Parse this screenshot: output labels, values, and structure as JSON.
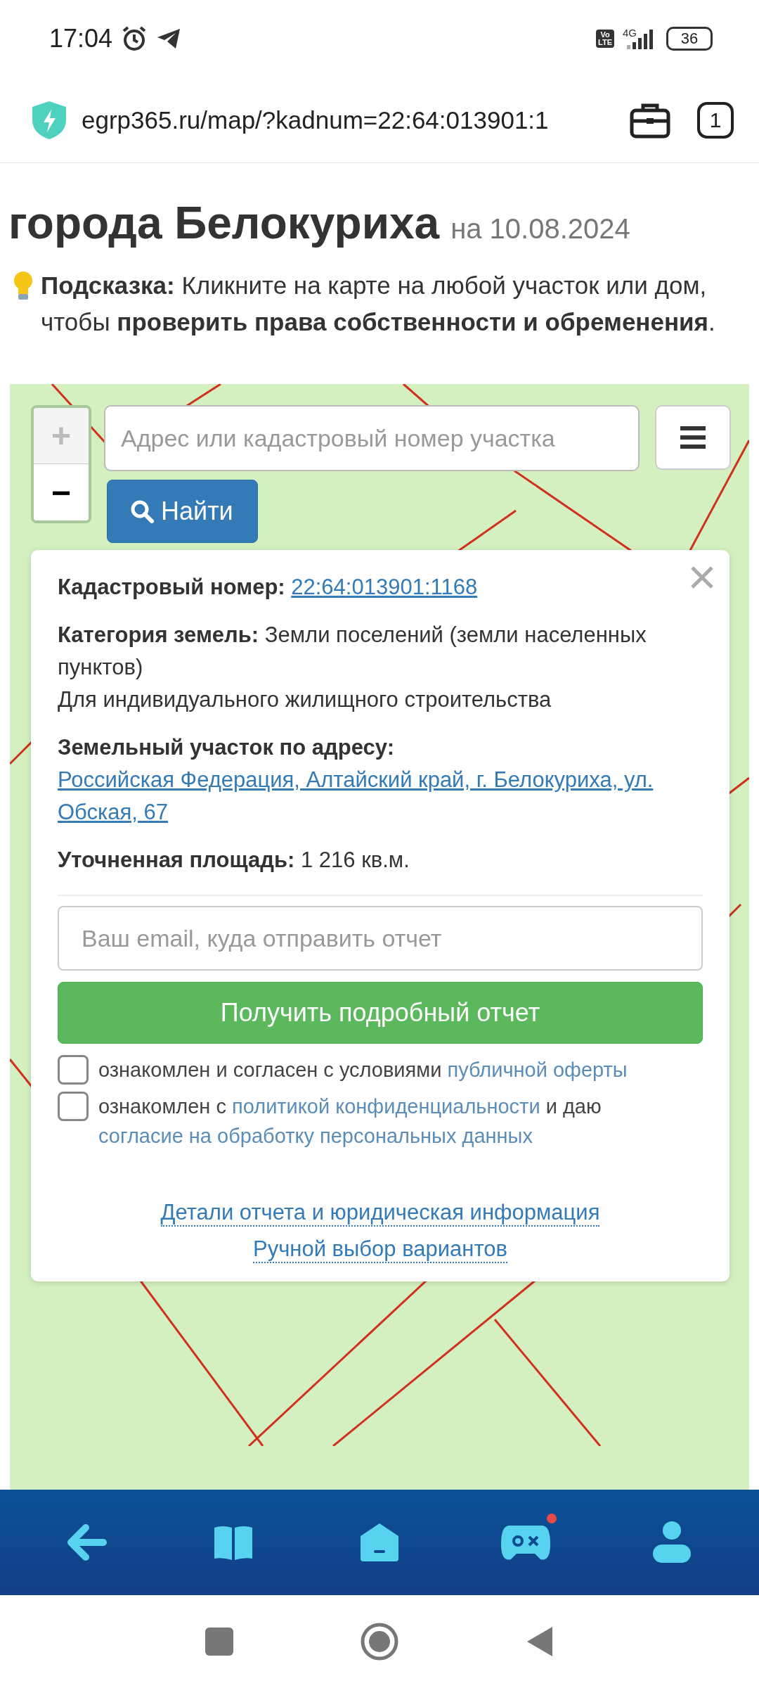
{
  "status_bar": {
    "time": "17:04",
    "volte": [
      "Vo",
      "LTE"
    ],
    "network": "4G",
    "battery": "36"
  },
  "browser": {
    "url": "egrp365.ru/map/?kadnum=22:64:013901:1",
    "tab_count": "1"
  },
  "heading": {
    "title": "города Белокуриха",
    "date": "на 10.08.2024"
  },
  "hint": "**Подсказка:** Кликните на карте на любой участок или дом, чтобы **проверить права собственности и обременения**.",
  "map": {
    "kind": "picture",
    "zoom_in": {
      "label": "+",
      "disabled": true
    },
    "zoom_out": {
      "label": "−",
      "disabled": false
    },
    "search": {
      "placeholder": "Адрес или кадастровый номер участка"
    },
    "find_button": "Найти"
  },
  "popup": {
    "fields": [
      {
        "label": "Кадастровый номер:",
        "value": "22:64:013901:1168",
        "kind": "link"
      },
      {
        "label": "Категория земель:",
        "value": "Земли поселений (земли населенных пунктов)",
        "note": "Для индивидуального жилищного строительства",
        "kind": "text"
      },
      {
        "label": "Земельный участок по адресу:",
        "value": "Российская Федерация, Алтайский край, г. Белокуриха, ул. Обская, 67",
        "kind": "link"
      },
      {
        "label": "Уточненная площадь:",
        "value": "1 216 кв.м.",
        "kind": "text"
      }
    ],
    "email": {
      "placeholder": "Ваш email, куда отправить отчет"
    },
    "submit": "Получить подробный отчет",
    "consents": [
      {
        "checked": false,
        "parts": [
          {
            "text": "ознакомлен и согласен с условиями ",
            "link": false
          },
          {
            "text": "публичной оферты",
            "link": true
          }
        ]
      },
      {
        "checked": false,
        "parts": [
          {
            "text": "ознакомлен с ",
            "link": false
          },
          {
            "text": "политикой конфиденциальности",
            "link": true
          },
          {
            "text": " и даю ",
            "link": false
          },
          {
            "text": "согласие на обработку персональных данных",
            "link": true
          }
        ]
      }
    ],
    "links": [
      "Детали отчета и юридическая информация",
      "Ручной выбор вариантов"
    ]
  },
  "bottom_nav": [
    {
      "kind": "back",
      "notification": false
    },
    {
      "kind": "book",
      "notification": false
    },
    {
      "kind": "home",
      "notification": false
    },
    {
      "kind": "game",
      "notification": true
    },
    {
      "kind": "profile",
      "notification": false
    }
  ]
}
